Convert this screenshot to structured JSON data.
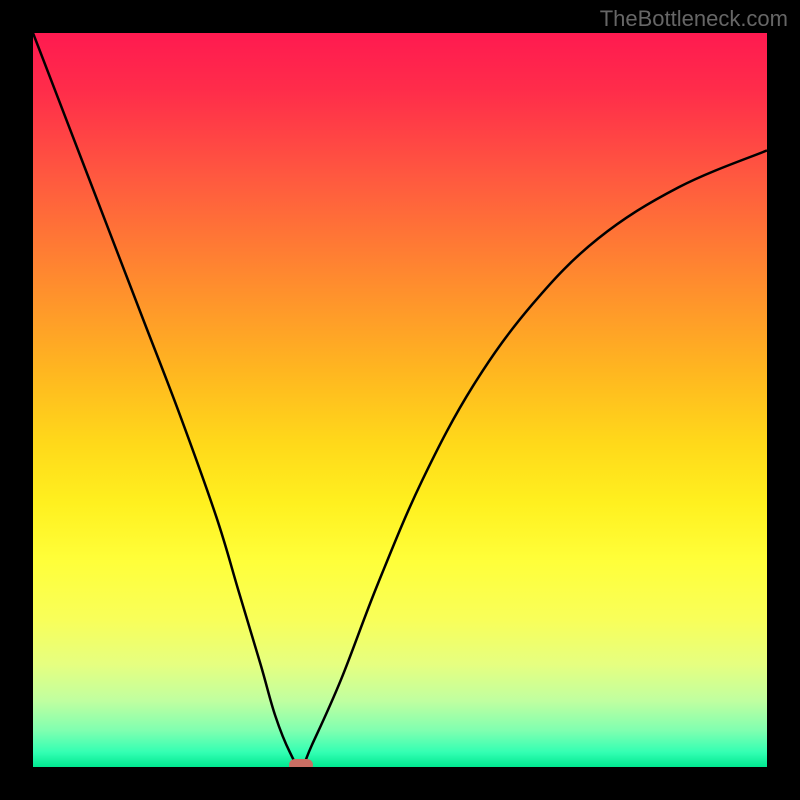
{
  "watermark": "TheBottleneck.com",
  "chart_data": {
    "type": "line",
    "title": "",
    "xlabel": "",
    "ylabel": "",
    "xlim": [
      0,
      100
    ],
    "ylim": [
      0,
      100
    ],
    "series": [
      {
        "name": "curve",
        "x": [
          0,
          5,
          10,
          15,
          20,
          25,
          28,
          31,
          33,
          35,
          36.5,
          38,
          42,
          47,
          53,
          60,
          68,
          77,
          88,
          100
        ],
        "y": [
          100,
          87,
          74,
          61,
          48,
          34,
          24,
          14,
          7,
          2,
          0,
          3,
          12,
          25,
          39,
          52,
          63,
          72,
          79,
          84
        ]
      }
    ],
    "marker": {
      "x": 36.5,
      "y": 0
    }
  },
  "colors": {
    "curve": "#000000",
    "marker": "#c96e63"
  }
}
